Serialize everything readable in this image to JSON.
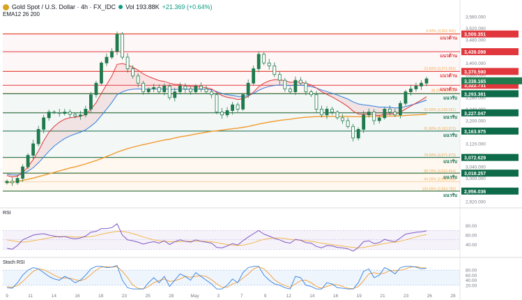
{
  "header": {
    "symbol": "Gold Spot / U.S. Dollar · 4h · FX_IDC",
    "volume": "Vol 193.88K",
    "change": "+21.369 (+0.64%)",
    "ema_label": "EMA12 26 200"
  },
  "colors": {
    "resistance": "#e0363c",
    "support": "#0e6b4a",
    "fib": "#f29a2e",
    "ema_fast": "#e0363c",
    "ema_slow": "#2f7fe0",
    "ema_200": "#f29a2e",
    "candle": "#1f7a4d",
    "rsi": "#7e57c2",
    "rsi_ma": "#f2b84b"
  },
  "chart_data": {
    "type": "candlestick",
    "symbol": "XAUUSD 4h",
    "x_ticks": [
      "9",
      "11",
      "14",
      "16",
      "18",
      "23",
      "25",
      "28",
      "May",
      "3",
      "7",
      "9",
      "12",
      "14",
      "16",
      "19",
      "21",
      "23",
      "26",
      "28"
    ],
    "y_ticks": [
      "3,560.000",
      "3,520.000",
      "3,480.000",
      "3,440.000",
      "3,400.000",
      "3,360.000",
      "3,320.000",
      "3,280.000",
      "3,240.000",
      "3,200.000",
      "3,160.000",
      "3,120.000",
      "3,080.000",
      "3,040.000",
      "3,000.000",
      "2,960.000",
      "2,920.000"
    ],
    "ylim": [
      2905,
      3565
    ],
    "close_path": [
      2990,
      2985,
      3000,
      3040,
      3080,
      3120,
      3170,
      3210,
      3230,
      3228,
      3225,
      3230,
      3222,
      3216,
      3220,
      3240,
      3290,
      3330,
      3400,
      3420,
      3440,
      3500,
      3420,
      3380,
      3355,
      3330,
      3300,
      3310,
      3315,
      3300,
      3320,
      3280,
      3300,
      3320,
      3310,
      3300,
      3320,
      3310,
      3300,
      3290,
      3230,
      3220,
      3235,
      3255,
      3240,
      3290,
      3330,
      3380,
      3430,
      3400,
      3390,
      3360,
      3340,
      3310,
      3300,
      3340,
      3330,
      3300,
      3290,
      3240,
      3220,
      3240,
      3230,
      3210,
      3200,
      3180,
      3140,
      3170,
      3220,
      3230,
      3200,
      3210,
      3240,
      3230,
      3220,
      3260,
      3300,
      3310,
      3320,
      3330,
      3345
    ],
    "ema12": [
      3010,
      3005,
      3008,
      3020,
      3040,
      3065,
      3095,
      3130,
      3160,
      3180,
      3195,
      3205,
      3210,
      3212,
      3215,
      3222,
      3240,
      3262,
      3295,
      3325,
      3355,
      3395,
      3398,
      3393,
      3385,
      3375,
      3362,
      3353,
      3346,
      3339,
      3336,
      3330,
      3326,
      3325,
      3322,
      3319,
      3319,
      3317,
      3314,
      3310,
      3298,
      3287,
      3281,
      3278,
      3273,
      3276,
      3284,
      3299,
      3318,
      3330,
      3338,
      3342,
      3342,
      3338,
      3333,
      3334,
      3334,
      3329,
      3324,
      3313,
      3300,
      3291,
      3282,
      3272,
      3261,
      3249,
      3233,
      3223,
      3222,
      3223,
      3220,
      3218,
      3222,
      3223,
      3223,
      3229,
      3240,
      3251,
      3261,
      3271,
      3283
    ],
    "ema26": [
      3015,
      3012,
      3012,
      3016,
      3025,
      3037,
      3054,
      3074,
      3094,
      3112,
      3126,
      3138,
      3147,
      3154,
      3160,
      3168,
      3181,
      3196,
      3218,
      3240,
      3263,
      3290,
      3300,
      3306,
      3309,
      3310,
      3309,
      3309,
      3310,
      3309,
      3310,
      3308,
      3308,
      3309,
      3309,
      3308,
      3309,
      3309,
      3308,
      3307,
      3301,
      3294,
      3290,
      3288,
      3284,
      3284,
      3287,
      3294,
      3305,
      3313,
      3319,
      3322,
      3324,
      3323,
      3321,
      3323,
      3323,
      3321,
      3318,
      3313,
      3306,
      3301,
      3295,
      3289,
      3282,
      3275,
      3265,
      3258,
      3255,
      3253,
      3250,
      3247,
      3247,
      3246,
      3244,
      3245,
      3249,
      3254,
      3259,
      3265,
      3271
    ],
    "ema200": [
      2985,
      2987,
      2990,
      2993,
      2997,
      3001,
      3006,
      3011,
      3016,
      3021,
      3026,
      3031,
      3036,
      3040,
      3045,
      3050,
      3056,
      3062,
      3069,
      3076,
      3083,
      3091,
      3097,
      3103,
      3108,
      3113,
      3117,
      3121,
      3125,
      3129,
      3133,
      3136,
      3140,
      3144,
      3147,
      3150,
      3154,
      3157,
      3160,
      3163,
      3165,
      3167,
      3170,
      3172,
      3174,
      3177,
      3180,
      3184,
      3188,
      3192,
      3195,
      3198,
      3201,
      3203,
      3205,
      3208,
      3210,
      3212,
      3213,
      3214,
      3214,
      3215,
      3215,
      3215,
      3215,
      3215,
      3214,
      3214,
      3214,
      3215,
      3215,
      3215,
      3216,
      3216,
      3216,
      3217,
      3218,
      3219,
      3220,
      3221,
      3223
    ],
    "levels": [
      {
        "value": 3500.351,
        "label": "3,500.351",
        "tag": "แนวต้าน",
        "kind": "resistance"
      },
      {
        "value": 3439.099,
        "label": "3,439.099",
        "tag": "แนวต้าน",
        "kind": "resistance"
      },
      {
        "value": 3370.59,
        "label": "3,370.590",
        "tag": "แนวต้าน",
        "kind": "resistance"
      },
      {
        "value": 3322.731,
        "label": "3,322.731",
        "tag": "แนวต้าน",
        "kind": "resistance"
      },
      {
        "value": 3293.381,
        "label": "3,293.381",
        "tag": "แนวรับ",
        "kind": "support"
      },
      {
        "value": 3227.047,
        "label": "3,227.047",
        "tag": "แนวรับ",
        "kind": "support"
      },
      {
        "value": 3163.975,
        "label": "3,163.975",
        "tag": "แนวรับ",
        "kind": "support"
      },
      {
        "value": 3072.629,
        "label": "3,072.629",
        "tag": "แนวรับ",
        "kind": "support"
      },
      {
        "value": 3018.257,
        "label": "3,018.257",
        "tag": "แนวรับ",
        "kind": "support"
      },
      {
        "value": 2956.036,
        "label": "2,956.036",
        "tag": "แนวรับ",
        "kind": "support"
      }
    ],
    "fib_levels": [
      {
        "value": 3502.4,
        "label": "0.00% (3,502.400)"
      },
      {
        "value": 3371.963,
        "label": "23.60% (3,371.963)"
      },
      {
        "value": 3296,
        "label": "38.20% (3,296)"
      },
      {
        "value": 3228.591,
        "label": "50.00% (3,228.591)"
      },
      {
        "value": 3163.972,
        "label": "61.80% (3,163.972)"
      },
      {
        "value": 3071.973,
        "label": "78.60% (3,071.973)"
      },
      {
        "value": 3016.664,
        "label": "88.70% (3,016.664)"
      },
      {
        "value": 2988.543,
        "label": "94.20% (2,988.543)"
      },
      {
        "value": 2954.783,
        "label": "100.00% (2,954.783)"
      }
    ],
    "current_price": {
      "value": 3338.165,
      "label": "3,338.165"
    },
    "rsi": {
      "title": "RSI",
      "ylim": [
        20,
        100
      ],
      "ticks": [
        "80.00",
        "60.00",
        "40.00"
      ],
      "band": [
        30,
        70
      ],
      "values": [
        32,
        30,
        38,
        50,
        55,
        60,
        62,
        63,
        60,
        58,
        56,
        57,
        54,
        52,
        54,
        58,
        66,
        68,
        74,
        74,
        76,
        84,
        60,
        50,
        48,
        45,
        41,
        44,
        46,
        43,
        48,
        40,
        46,
        50,
        47,
        45,
        50,
        47,
        45,
        43,
        34,
        33,
        37,
        42,
        39,
        48,
        56,
        63,
        70,
        62,
        58,
        53,
        50,
        45,
        43,
        51,
        49,
        44,
        43,
        36,
        33,
        38,
        37,
        34,
        33,
        31,
        26,
        34,
        46,
        48,
        42,
        44,
        51,
        48,
        46,
        54,
        62,
        64,
        66,
        67,
        69
      ],
      "ma": [
        50,
        48,
        46,
        45,
        46,
        48,
        50,
        52,
        54,
        56,
        57,
        57,
        57,
        56,
        56,
        56,
        57,
        59,
        62,
        64,
        66,
        68,
        68,
        66,
        63,
        60,
        56,
        53,
        50,
        48,
        47,
        46,
        46,
        46,
        47,
        47,
        47,
        47,
        47,
        46,
        44,
        42,
        40,
        39,
        38,
        39,
        41,
        44,
        48,
        51,
        53,
        54,
        54,
        53,
        51,
        50,
        49,
        48,
        47,
        45,
        43,
        41,
        40,
        38,
        37,
        35,
        34,
        33,
        34,
        36,
        38,
        40,
        42,
        44,
        45,
        47,
        50,
        53,
        56,
        59,
        61
      ]
    },
    "stoch": {
      "title": "Stoch RSI",
      "ylim": [
        0,
        100
      ],
      "ticks": [
        "80.00",
        "60.00",
        "40.00",
        "20.00"
      ],
      "band": [
        20,
        80
      ],
      "k": [
        10,
        8,
        30,
        60,
        80,
        90,
        85,
        70,
        55,
        45,
        40,
        55,
        45,
        30,
        40,
        60,
        85,
        95,
        95,
        90,
        92,
        98,
        40,
        10,
        5,
        5,
        5,
        30,
        50,
        30,
        55,
        15,
        40,
        65,
        55,
        40,
        70,
        55,
        40,
        25,
        5,
        5,
        20,
        45,
        30,
        70,
        90,
        95,
        95,
        60,
        40,
        25,
        20,
        10,
        5,
        55,
        50,
        20,
        15,
        5,
        5,
        30,
        25,
        10,
        8,
        5,
        5,
        30,
        75,
        85,
        50,
        60,
        90,
        80,
        65,
        90,
        95,
        95,
        92,
        85,
        88
      ],
      "d": [
        15,
        12,
        18,
        35,
        55,
        75,
        85,
        82,
        72,
        60,
        50,
        48,
        48,
        42,
        38,
        45,
        62,
        80,
        92,
        94,
        92,
        94,
        75,
        50,
        20,
        8,
        5,
        15,
        30,
        38,
        45,
        35,
        38,
        45,
        55,
        52,
        55,
        58,
        55,
        42,
        25,
        12,
        12,
        25,
        32,
        48,
        65,
        85,
        93,
        85,
        65,
        42,
        28,
        18,
        12,
        25,
        38,
        40,
        30,
        15,
        8,
        15,
        22,
        22,
        15,
        8,
        6,
        15,
        38,
        65,
        70,
        65,
        68,
        78,
        78,
        80,
        85,
        92,
        94,
        90,
        88
      ]
    }
  }
}
